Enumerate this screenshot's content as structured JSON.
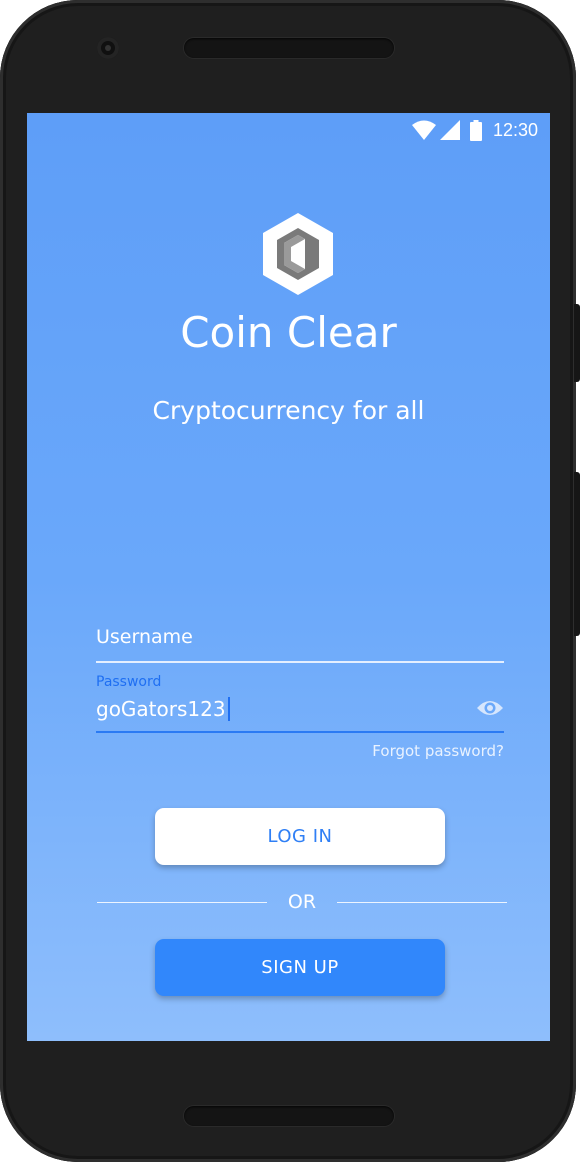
{
  "status_bar": {
    "time": "12:30",
    "icons": [
      "wifi-icon",
      "signal-icon",
      "battery-icon"
    ]
  },
  "app": {
    "logo_icon": "hexagon-coin-logo",
    "title": "Coin Clear",
    "tagline": "Cryptocurrency for all"
  },
  "login_form": {
    "username_placeholder": "Username",
    "password_label": "Password",
    "password_value": "goGators123",
    "password_visibility_icon": "eye-icon",
    "forgot_password": "Forgot password?"
  },
  "actions": {
    "login_label": "LOG IN",
    "divider_text": "OR",
    "signup_label": "SIGN UP"
  },
  "colors": {
    "background_top": "#5e9ef8",
    "background_bottom": "#8ebefc",
    "accent": "#2f7ff5",
    "signup_button": "#3187fb",
    "login_button": "#ffffff"
  }
}
